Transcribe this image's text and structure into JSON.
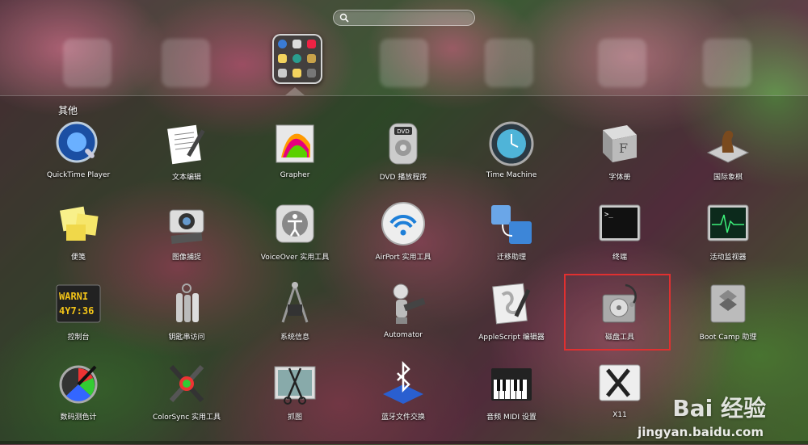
{
  "folder": {
    "title": "其他"
  },
  "search": {
    "placeholder": ""
  },
  "apps": [
    {
      "label": "QuickTime Player",
      "icon": "quicktime-icon"
    },
    {
      "label": "文本编辑",
      "icon": "textedit-icon"
    },
    {
      "label": "Grapher",
      "icon": "grapher-icon"
    },
    {
      "label": "DVD 播放程序",
      "icon": "dvd-player-icon"
    },
    {
      "label": "Time Machine",
      "icon": "time-machine-icon"
    },
    {
      "label": "字体册",
      "icon": "font-book-icon"
    },
    {
      "label": "国际象棋",
      "icon": "chess-icon"
    },
    {
      "label": "便笺",
      "icon": "stickies-icon"
    },
    {
      "label": "图像捕捉",
      "icon": "image-capture-icon"
    },
    {
      "label": "VoiceOver 实用工具",
      "icon": "voiceover-icon"
    },
    {
      "label": "AirPort 实用工具",
      "icon": "airport-icon"
    },
    {
      "label": "迁移助理",
      "icon": "migration-assistant-icon"
    },
    {
      "label": "终端",
      "icon": "terminal-icon"
    },
    {
      "label": "活动监视器",
      "icon": "activity-monitor-icon"
    },
    {
      "label": "控制台",
      "icon": "console-icon"
    },
    {
      "label": "钥匙串访问",
      "icon": "keychain-icon"
    },
    {
      "label": "系统信息",
      "icon": "system-information-icon"
    },
    {
      "label": "Automator",
      "icon": "automator-icon"
    },
    {
      "label": "AppleScript 编辑器",
      "icon": "applescript-icon"
    },
    {
      "label": "磁盘工具",
      "icon": "disk-utility-icon"
    },
    {
      "label": "Boot Camp 助理",
      "icon": "boot-camp-icon"
    },
    {
      "label": "数码测色计",
      "icon": "digital-color-meter-icon"
    },
    {
      "label": "ColorSync 实用工具",
      "icon": "colorsync-icon"
    },
    {
      "label": "抓图",
      "icon": "grab-icon"
    },
    {
      "label": "蓝牙文件交换",
      "icon": "bluetooth-icon"
    },
    {
      "label": "音频 MIDI 设置",
      "icon": "audio-midi-icon"
    },
    {
      "label": "X11",
      "icon": "x11-icon"
    }
  ],
  "watermark": {
    "brand": "Bai 经验",
    "url": "jingyan.baidu.com"
  },
  "colors": {
    "highlight": "#e03030"
  }
}
